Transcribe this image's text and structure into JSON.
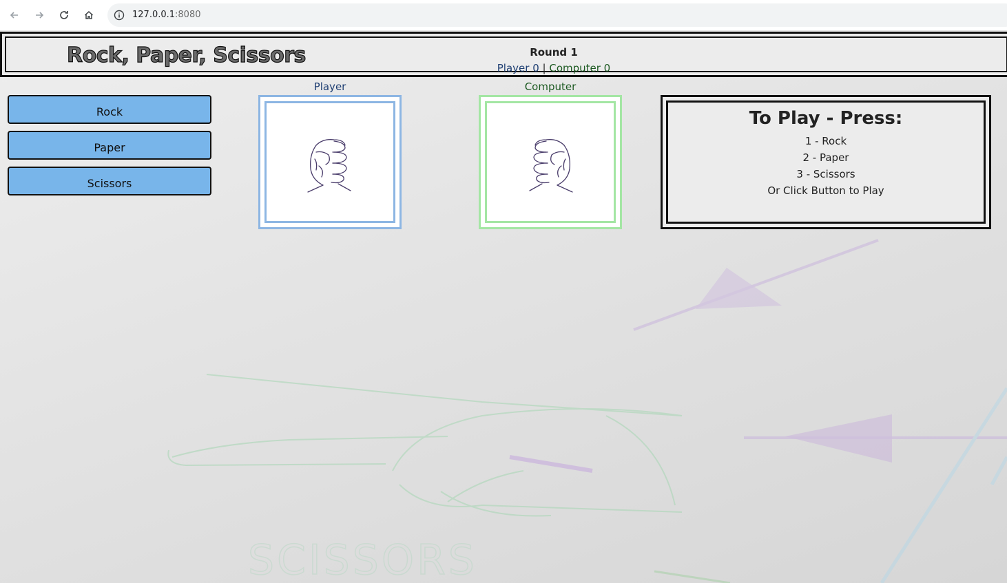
{
  "browser": {
    "url_host": "127.0.0.1",
    "url_port": ":8080",
    "back_icon": "arrow-left-icon",
    "forward_icon": "arrow-right-icon",
    "reload_icon": "reload-icon",
    "home_icon": "home-icon",
    "info_icon": "info-icon"
  },
  "header": {
    "title": "Rock, Paper, Scissors",
    "round": "Round 1",
    "player_score": "Player 0",
    "separator": " | ",
    "computer_score": "Computer 0"
  },
  "buttons": [
    {
      "label": "Rock"
    },
    {
      "label": "Paper"
    },
    {
      "label": "Scissors"
    }
  ],
  "hands": {
    "player_label": "Player",
    "computer_label": "Computer",
    "player_choice_icon": "fist-icon",
    "computer_choice_icon": "fist-icon"
  },
  "instructions": {
    "title": "To Play - Press:",
    "lines": [
      "1 - Rock",
      "2 - Paper",
      "3 - Scissors",
      "Or Click Button to Play"
    ]
  },
  "background": {
    "watermark_text": "SCISSORS"
  },
  "colors": {
    "button_blue": "#78b5ea",
    "player_frame": "#8db6e3",
    "computer_frame": "#a4e6a4",
    "player_text": "#1f3f73",
    "computer_text": "#1d5a22"
  }
}
